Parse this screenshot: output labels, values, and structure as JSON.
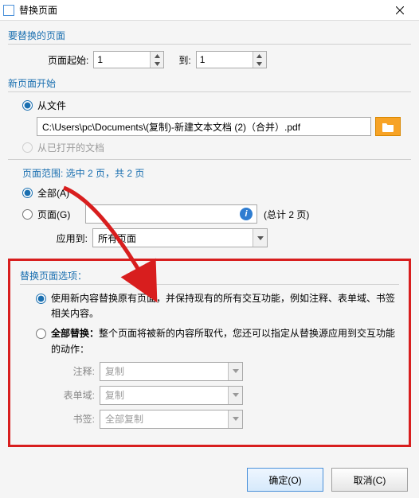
{
  "window": {
    "title": "替换页面"
  },
  "groups": {
    "pages_to_replace": "要替换的页面",
    "new_page_start": "新页面开始",
    "replace_options": "替换页面选项："
  },
  "page_range": {
    "start_label": "页面起始:",
    "start_value": "1",
    "to_label": "到:",
    "end_value": "1"
  },
  "source": {
    "from_file": "从文件",
    "file_path": "C:\\Users\\pc\\Documents\\(复制)-新建文本文档 (2)（合并）.pdf",
    "from_open": "从已打开的文档"
  },
  "range_info": {
    "heading": "页面范围: 选中 2 页，共 2 页",
    "all": "全部(A)",
    "pages": "页面(G)",
    "pages_value": "",
    "total": "(总计 2 页)",
    "apply_to_label": "应用到:",
    "apply_to_value": "所有页面"
  },
  "replace_opts": {
    "opt1": "使用新内容替换原有页面，并保持现有的所有交互功能，例如注释、表单域、书签相关内容。",
    "opt2_bold": "全部替换：",
    "opt2_rest": "整个页面将被新的内容所取代，您还可以指定从替换源应用到交互功能的动作：",
    "annot_label": "注释:",
    "annot_value": "复制",
    "form_label": "表单域:",
    "form_value": "复制",
    "bookmark_label": "书签:",
    "bookmark_value": "全部复制"
  },
  "buttons": {
    "ok": "确定(O)",
    "cancel": "取消(C)"
  }
}
